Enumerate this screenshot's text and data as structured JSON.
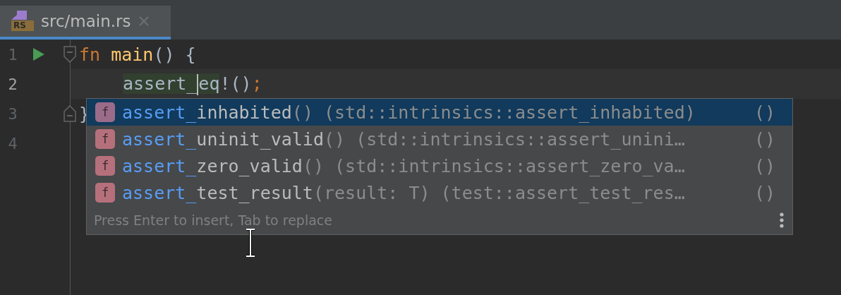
{
  "tab": {
    "title": "src/main.rs",
    "icon_label": "RS",
    "selected": true
  },
  "lines": [
    {
      "number": "1",
      "run": true,
      "fold_start": true,
      "fold_end": false,
      "current": false,
      "indented": false,
      "tokens": [
        {
          "text": "fn ",
          "kind": "keyword"
        },
        {
          "text": "main",
          "kind": "function"
        },
        {
          "text": "() {",
          "kind": "plain"
        }
      ]
    },
    {
      "number": "2",
      "run": false,
      "fold_start": false,
      "fold_end": false,
      "current": true,
      "indented": true,
      "tokens": [
        {
          "text": "assert_",
          "kind": "match-caret"
        },
        {
          "text": "eq",
          "kind": "match"
        },
        {
          "text": "!()",
          "kind": "plain"
        },
        {
          "text": ";",
          "kind": "keyword"
        }
      ]
    },
    {
      "number": "3",
      "run": false,
      "fold_start": false,
      "fold_end": true,
      "current": false,
      "indented": false,
      "tokens": [
        {
          "text": "}",
          "kind": "plain"
        }
      ]
    },
    {
      "number": "4",
      "run": false,
      "fold_start": false,
      "fold_end": false,
      "current": false
    }
  ],
  "completion": {
    "items": [
      {
        "icon_label": "f",
        "match": "assert_",
        "name": "inhabited",
        "signature": "() (std::intrinsics::assert_inhabited)",
        "type": "()",
        "selected": true
      },
      {
        "icon_label": "f",
        "match": "assert_",
        "name": "uninit_valid",
        "signature": "() (std::intrinsics::assert_unini…",
        "type": "()",
        "selected": false
      },
      {
        "icon_label": "f",
        "match": "assert_",
        "name": "zero_valid",
        "signature": "() (std::intrinsics::assert_zero_va…",
        "type": "()",
        "selected": false
      },
      {
        "icon_label": "f",
        "match": "assert_",
        "name": "test_result",
        "signature": "(result: T) (test::assert_test_res…",
        "type": "()",
        "selected": false
      }
    ],
    "hint": "Press Enter to insert, Tab to replace"
  }
}
